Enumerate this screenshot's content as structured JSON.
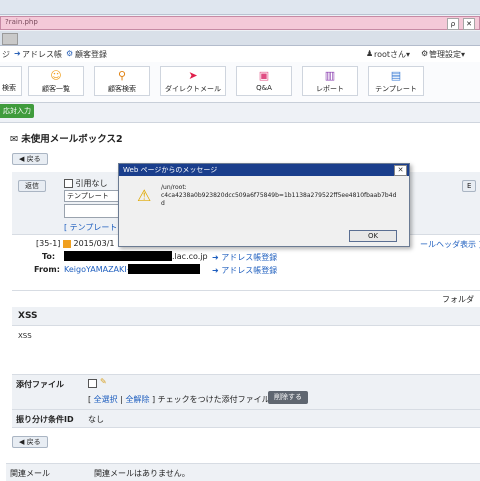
{
  "browser": {
    "address_text": "?rain.php",
    "search_icon_glyph": "ρ",
    "close_icon_glyph": "✕"
  },
  "topbar": {
    "left_item1": "ジ",
    "address_book": "アドレス帳",
    "customer_reg": "顧客登録",
    "user": "rootさん▾",
    "settings": "管理設定▾"
  },
  "nav": {
    "items": [
      {
        "label": "検索",
        "icon": "search-icon"
      },
      {
        "label": "顧客一覧",
        "icon": "customer-list-icon"
      },
      {
        "label": "顧客検索",
        "icon": "customer-search-icon"
      },
      {
        "label": "ダイレクトメール",
        "icon": "paper-plane-icon"
      },
      {
        "label": "Q&A",
        "icon": "qa-icon"
      },
      {
        "label": "レポート",
        "icon": "chart-icon"
      },
      {
        "label": "テンプレート",
        "icon": "template-icon"
      }
    ],
    "green_button": "応対入力"
  },
  "mailbox": {
    "title": "未使用メールボックス2",
    "back_label": "戻る",
    "reply_label": "返信",
    "quote_none": "引用なし",
    "template_select": "テンプレート",
    "template_link": "[ テンプレート",
    "right_button": "E",
    "mail_index": "[35-1]",
    "date": "2015/03/1",
    "to_label": "To:",
    "to_domain": ".lac.co.jp",
    "address_register": "アドレス帳登録",
    "from_label": "From:",
    "from_name": "KeigoYAMAZAKI<",
    "header_display": "ールヘッダ表示 ]",
    "folder_label": "フォルダ",
    "subject": "XSS",
    "body": "XSS",
    "attachment_label": "添付ファイル",
    "select_all": "全選択",
    "deselect_all": "全解除",
    "attach_note": "] チェックをつけた添付ファイルを",
    "delete_button": "削除する",
    "sort_label": "振り分け条件ID",
    "sort_value": "なし",
    "related_label": "関連メール",
    "related_value": "関連メールはありません。"
  },
  "dialog": {
    "title": "Web ページからのメッセージ",
    "message_line1": "/un/root:",
    "message_line2": "c4ca4238a0b923820dcc509a6f75849b=1b1138a279522ff5ee4810fbaab7b4d",
    "message_line3": "d",
    "ok_label": "OK"
  }
}
